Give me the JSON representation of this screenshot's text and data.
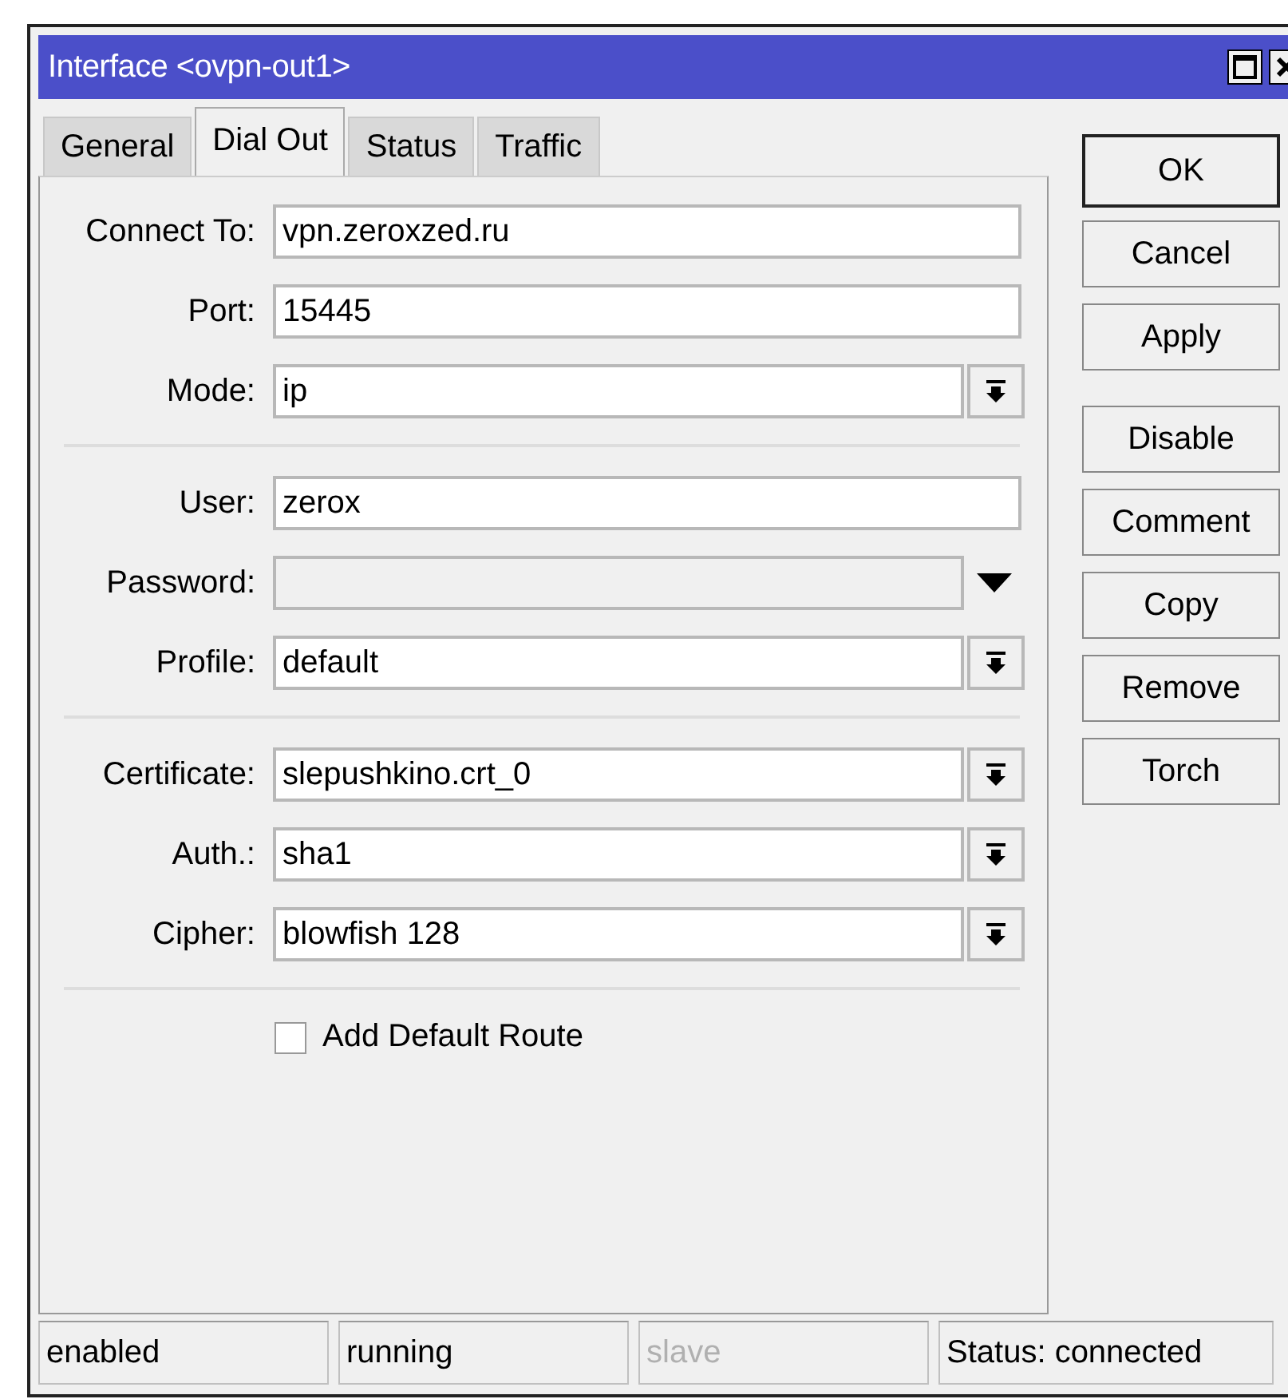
{
  "window": {
    "title": "Interface <ovpn-out1>"
  },
  "tabs": [
    {
      "label": "General",
      "selected": false
    },
    {
      "label": "Dial Out",
      "selected": true
    },
    {
      "label": "Status",
      "selected": false
    },
    {
      "label": "Traffic",
      "selected": false
    }
  ],
  "sections": [
    {
      "fields": [
        {
          "label": "Connect To:",
          "value": "vpn.zeroxzed.ru",
          "kind": "text",
          "disabled": false
        },
        {
          "label": "Port:",
          "value": "15445",
          "kind": "text",
          "disabled": false
        },
        {
          "label": "Mode:",
          "value": "ip",
          "kind": "select",
          "disabled": false
        }
      ]
    },
    {
      "fields": [
        {
          "label": "User:",
          "value": "zerox",
          "kind": "text",
          "disabled": false
        },
        {
          "label": "Password:",
          "kind": "reveal",
          "disabled": true
        },
        {
          "label": "Profile:",
          "value": "default",
          "kind": "select",
          "disabled": false
        }
      ]
    },
    {
      "fields": [
        {
          "label": "Certificate:",
          "value": "slepushkino.crt_0",
          "kind": "select",
          "disabled": false
        },
        {
          "label": "Auth.:",
          "value": "sha1",
          "kind": "select",
          "disabled": false
        },
        {
          "label": "Cipher:",
          "value": "blowfish 128",
          "kind": "select",
          "disabled": false
        }
      ]
    }
  ],
  "checkbox": {
    "label": "Add Default Route",
    "checked": false
  },
  "button_groups": [
    {
      "buttons": [
        {
          "label": "OK",
          "default": true
        },
        {
          "label": "Cancel",
          "default": false
        },
        {
          "label": "Apply",
          "default": false
        }
      ]
    },
    {
      "buttons": [
        {
          "label": "Disable",
          "default": false
        },
        {
          "label": "Comment",
          "default": false
        },
        {
          "label": "Copy",
          "default": false
        },
        {
          "label": "Remove",
          "default": false
        },
        {
          "label": "Torch",
          "default": false
        }
      ]
    }
  ],
  "status_bar": [
    {
      "text": "enabled",
      "disabled": false
    },
    {
      "text": "running",
      "disabled": false
    },
    {
      "text": "slave",
      "disabled": true
    },
    {
      "text": "Status: connected",
      "disabled": false
    }
  ]
}
